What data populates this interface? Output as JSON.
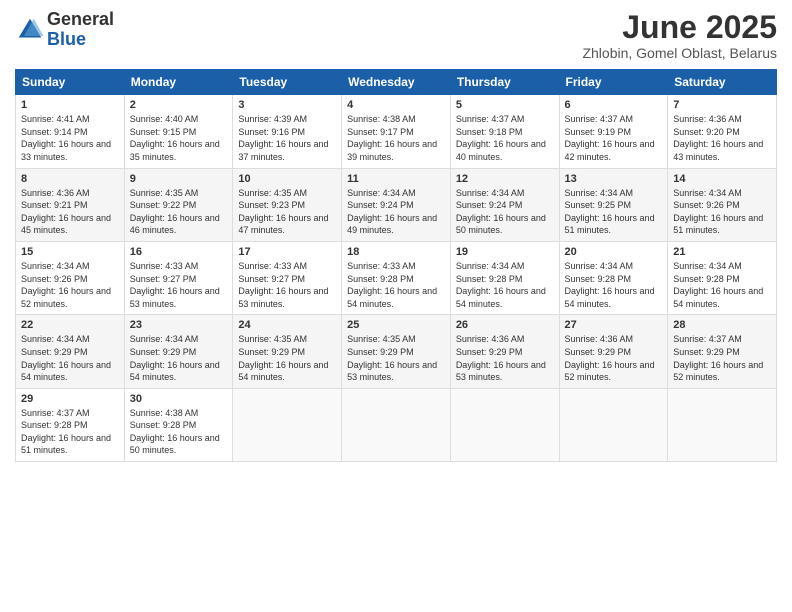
{
  "logo": {
    "general": "General",
    "blue": "Blue"
  },
  "title": "June 2025",
  "subtitle": "Zhlobin, Gomel Oblast, Belarus",
  "headers": [
    "Sunday",
    "Monday",
    "Tuesday",
    "Wednesday",
    "Thursday",
    "Friday",
    "Saturday"
  ],
  "weeks": [
    [
      {
        "day": "1",
        "sunrise": "4:41 AM",
        "sunset": "9:14 PM",
        "daylight": "16 hours and 33 minutes."
      },
      {
        "day": "2",
        "sunrise": "4:40 AM",
        "sunset": "9:15 PM",
        "daylight": "16 hours and 35 minutes."
      },
      {
        "day": "3",
        "sunrise": "4:39 AM",
        "sunset": "9:16 PM",
        "daylight": "16 hours and 37 minutes."
      },
      {
        "day": "4",
        "sunrise": "4:38 AM",
        "sunset": "9:17 PM",
        "daylight": "16 hours and 39 minutes."
      },
      {
        "day": "5",
        "sunrise": "4:37 AM",
        "sunset": "9:18 PM",
        "daylight": "16 hours and 40 minutes."
      },
      {
        "day": "6",
        "sunrise": "4:37 AM",
        "sunset": "9:19 PM",
        "daylight": "16 hours and 42 minutes."
      },
      {
        "day": "7",
        "sunrise": "4:36 AM",
        "sunset": "9:20 PM",
        "daylight": "16 hours and 43 minutes."
      }
    ],
    [
      {
        "day": "8",
        "sunrise": "4:36 AM",
        "sunset": "9:21 PM",
        "daylight": "16 hours and 45 minutes."
      },
      {
        "day": "9",
        "sunrise": "4:35 AM",
        "sunset": "9:22 PM",
        "daylight": "16 hours and 46 minutes."
      },
      {
        "day": "10",
        "sunrise": "4:35 AM",
        "sunset": "9:23 PM",
        "daylight": "16 hours and 47 minutes."
      },
      {
        "day": "11",
        "sunrise": "4:34 AM",
        "sunset": "9:24 PM",
        "daylight": "16 hours and 49 minutes."
      },
      {
        "day": "12",
        "sunrise": "4:34 AM",
        "sunset": "9:24 PM",
        "daylight": "16 hours and 50 minutes."
      },
      {
        "day": "13",
        "sunrise": "4:34 AM",
        "sunset": "9:25 PM",
        "daylight": "16 hours and 51 minutes."
      },
      {
        "day": "14",
        "sunrise": "4:34 AM",
        "sunset": "9:26 PM",
        "daylight": "16 hours and 51 minutes."
      }
    ],
    [
      {
        "day": "15",
        "sunrise": "4:34 AM",
        "sunset": "9:26 PM",
        "daylight": "16 hours and 52 minutes."
      },
      {
        "day": "16",
        "sunrise": "4:33 AM",
        "sunset": "9:27 PM",
        "daylight": "16 hours and 53 minutes."
      },
      {
        "day": "17",
        "sunrise": "4:33 AM",
        "sunset": "9:27 PM",
        "daylight": "16 hours and 53 minutes."
      },
      {
        "day": "18",
        "sunrise": "4:33 AM",
        "sunset": "9:28 PM",
        "daylight": "16 hours and 54 minutes."
      },
      {
        "day": "19",
        "sunrise": "4:34 AM",
        "sunset": "9:28 PM",
        "daylight": "16 hours and 54 minutes."
      },
      {
        "day": "20",
        "sunrise": "4:34 AM",
        "sunset": "9:28 PM",
        "daylight": "16 hours and 54 minutes."
      },
      {
        "day": "21",
        "sunrise": "4:34 AM",
        "sunset": "9:28 PM",
        "daylight": "16 hours and 54 minutes."
      }
    ],
    [
      {
        "day": "22",
        "sunrise": "4:34 AM",
        "sunset": "9:29 PM",
        "daylight": "16 hours and 54 minutes."
      },
      {
        "day": "23",
        "sunrise": "4:34 AM",
        "sunset": "9:29 PM",
        "daylight": "16 hours and 54 minutes."
      },
      {
        "day": "24",
        "sunrise": "4:35 AM",
        "sunset": "9:29 PM",
        "daylight": "16 hours and 54 minutes."
      },
      {
        "day": "25",
        "sunrise": "4:35 AM",
        "sunset": "9:29 PM",
        "daylight": "16 hours and 53 minutes."
      },
      {
        "day": "26",
        "sunrise": "4:36 AM",
        "sunset": "9:29 PM",
        "daylight": "16 hours and 53 minutes."
      },
      {
        "day": "27",
        "sunrise": "4:36 AM",
        "sunset": "9:29 PM",
        "daylight": "16 hours and 52 minutes."
      },
      {
        "day": "28",
        "sunrise": "4:37 AM",
        "sunset": "9:29 PM",
        "daylight": "16 hours and 52 minutes."
      }
    ],
    [
      {
        "day": "29",
        "sunrise": "4:37 AM",
        "sunset": "9:28 PM",
        "daylight": "16 hours and 51 minutes."
      },
      {
        "day": "30",
        "sunrise": "4:38 AM",
        "sunset": "9:28 PM",
        "daylight": "16 hours and 50 minutes."
      },
      null,
      null,
      null,
      null,
      null
    ]
  ]
}
